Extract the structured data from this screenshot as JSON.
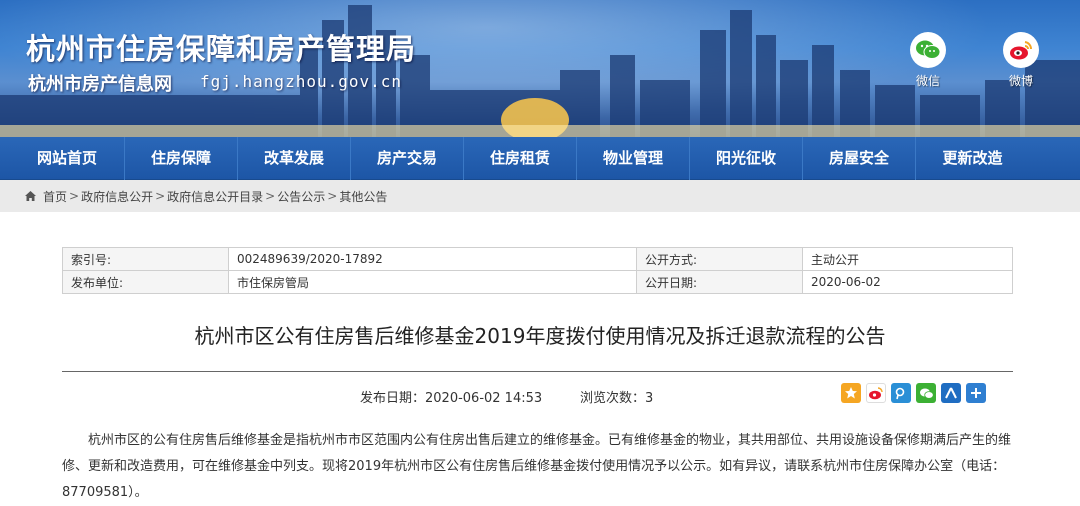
{
  "header": {
    "title": "杭州市住房保障和房产管理局",
    "subtitle": "杭州市房产信息网",
    "domain": "fgj.hangzhou.gov.cn",
    "social": [
      {
        "label": "微信",
        "icon": "wechat-icon",
        "color": "#3cb034"
      },
      {
        "label": "微博",
        "icon": "weibo-icon",
        "color": "#e6162d"
      }
    ]
  },
  "nav": {
    "items": [
      "网站首页",
      "住房保障",
      "改革发展",
      "房产交易",
      "住房租赁",
      "物业管理",
      "阳光征收",
      "房屋安全",
      "更新改造"
    ]
  },
  "breadcrumb": {
    "items": [
      "首页",
      "政府信息公开",
      "政府信息公开目录",
      "公告公示",
      "其他公告"
    ],
    "separator": ">"
  },
  "meta": {
    "index_label": "索引号:",
    "index_value": "002489639/2020-17892",
    "method_label": "公开方式:",
    "method_value": "主动公开",
    "publisher_label": "发布单位:",
    "publisher_value": "市住保房管局",
    "date_label": "公开日期:",
    "date_value": "2020-06-02"
  },
  "article": {
    "title": "杭州市区公有住房售后维修基金2019年度拨付使用情况及拆迁退款流程的公告",
    "publish_date_text": "发布日期：2020-06-02 14:53",
    "views_text": "浏览次数：3",
    "paragraph": "杭州市区的公有住房售后维修基金是指杭州市市区范围内公有住房出售后建立的维修基金。已有维修基金的物业，其共用部位、共用设施设备保修期满后产生的维修、更新和改造费用，可在维修基金中列支。现将2019年杭州市区公有住房售后维修基金拨付使用情况予以公示。如有异议，请联系杭州市住房保障办公室（电话：87709581）。"
  },
  "share": [
    {
      "icon": "qzone-icon",
      "color": "#f5a623"
    },
    {
      "icon": "weibo-icon",
      "color": "#e6162d"
    },
    {
      "icon": "tencent-weibo-icon",
      "color": "#2a8fd6"
    },
    {
      "icon": "wechat-icon",
      "color": "#3cb034"
    },
    {
      "icon": "renren-icon",
      "color": "#1f6dc2"
    },
    {
      "icon": "more-share-icon",
      "color": "#2f7fd1"
    }
  ]
}
